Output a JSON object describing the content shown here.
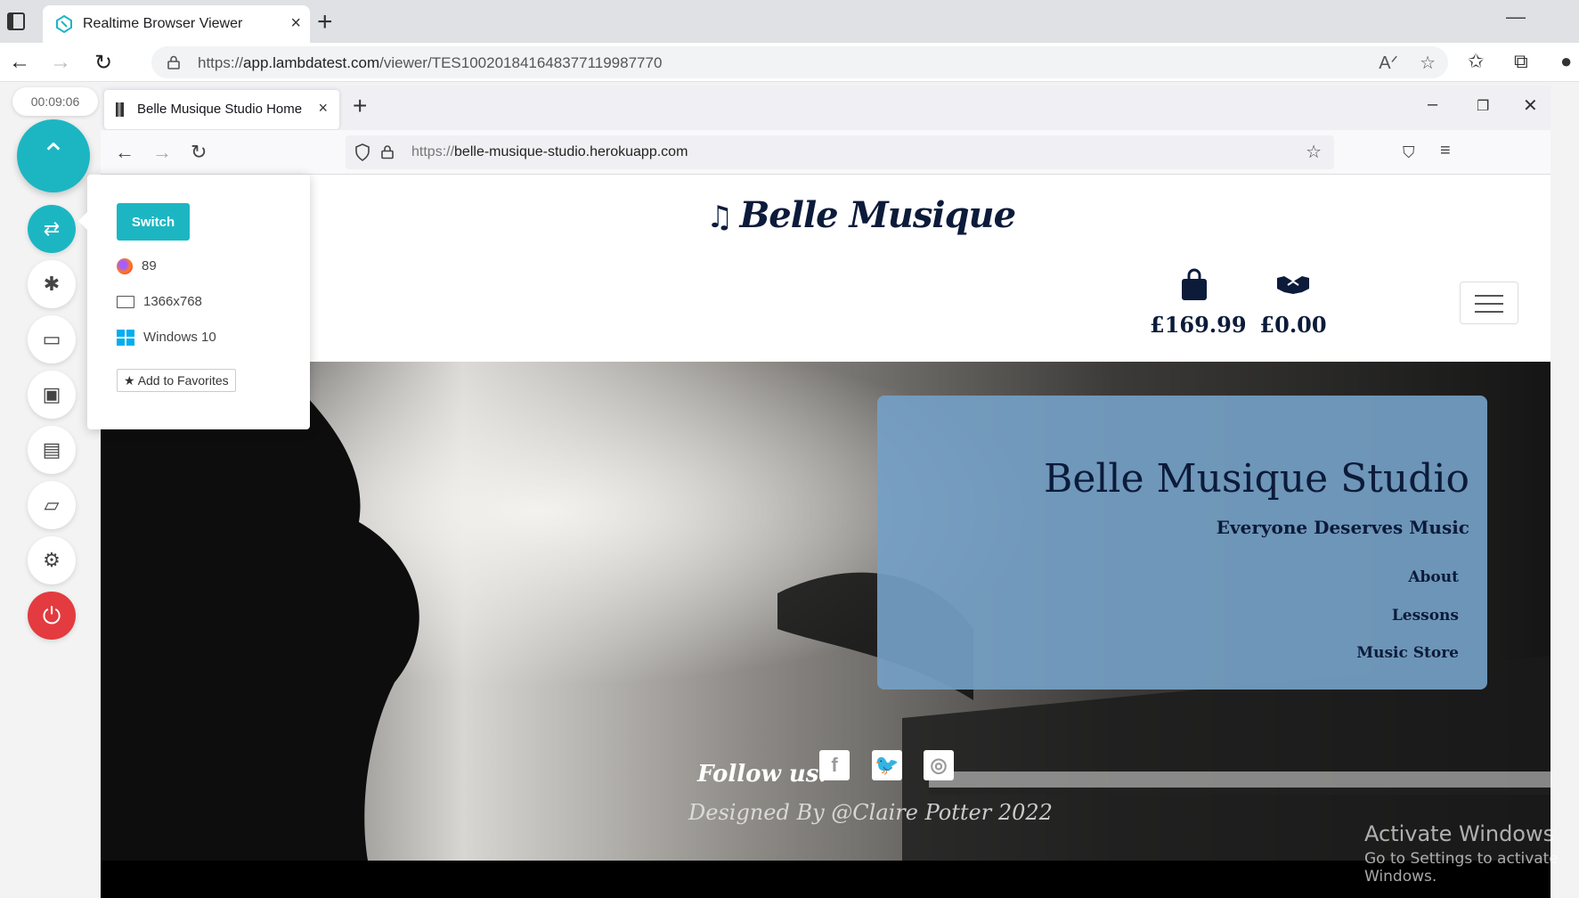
{
  "edge": {
    "tab_title": "Realtime Browser Viewer",
    "url_prefix": "https://",
    "url_host": "app.lambdatest.com",
    "url_path": "/viewer/TES100201841648377119987770",
    "newtab": "+",
    "close": "×",
    "min": "—"
  },
  "lt": {
    "timer": "00:09:06",
    "switch_label": "Switch",
    "browser_version": "89",
    "resolution": "1366x768",
    "os": "Windows 10",
    "fav_label": "Add to Favorites"
  },
  "firefox": {
    "tab_title": "Belle Musique Studio Home",
    "url_prefix": "https://",
    "url_host": "belle-musique-studio.herokuapp.com"
  },
  "site": {
    "logo_text": "Belle Musique",
    "cart_total": "£169.99",
    "deal_total": "£0.00",
    "hero_title": "Belle Musique Studio",
    "hero_tagline": "Everyone Deserves Music",
    "nav_links": [
      "About",
      "Lessons",
      "Music Store"
    ],
    "follow_text": "Follow us:",
    "designed_by": "Designed By @Claire Potter 2022"
  },
  "watermark": {
    "title": "Activate Windows",
    "sub": "Go to Settings to activate Windows."
  },
  "colors": {
    "accent": "#1cb6c3",
    "danger": "#e33b3f",
    "navy": "#0c1b3a",
    "card": "#74a0c4"
  }
}
